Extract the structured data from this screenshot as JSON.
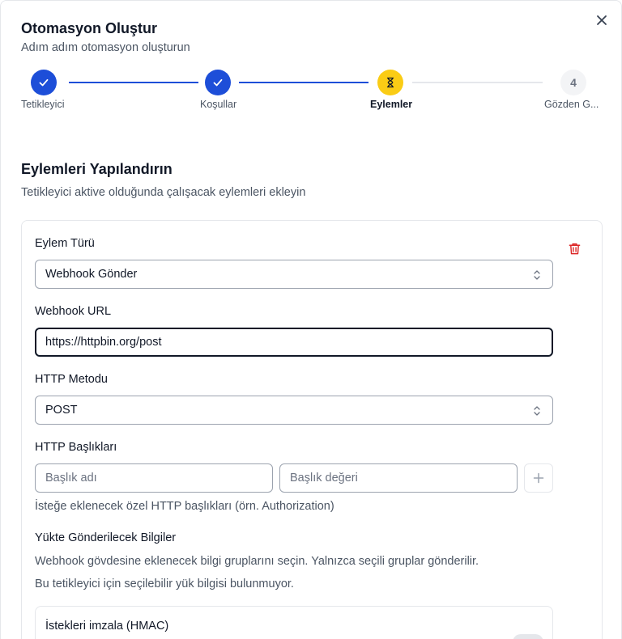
{
  "dialog": {
    "title": "Otomasyon Oluştur",
    "subtitle": "Adım adım otomasyon oluşturun"
  },
  "stepper": {
    "steps": [
      {
        "label": "Tetikleyici",
        "state": "done"
      },
      {
        "label": "Koşullar",
        "state": "done"
      },
      {
        "label": "Eylemler",
        "state": "active"
      },
      {
        "label": "Gözden G...",
        "state": "pending",
        "number": "4"
      }
    ]
  },
  "section": {
    "title": "Eylemleri Yapılandırın",
    "description": "Tetikleyici aktive olduğunda çalışacak eylemleri ekleyin"
  },
  "action": {
    "type_label": "Eylem Türü",
    "type_value": "Webhook Gönder",
    "url_label": "Webhook URL",
    "url_value": "https://httpbin.org/post",
    "method_label": "HTTP Metodu",
    "method_value": "POST",
    "headers_label": "HTTP Başlıkları",
    "header_name_placeholder": "Başlık adı",
    "header_value_placeholder": "Başlık değeri",
    "headers_helper": "İsteğe eklenecek özel HTTP başlıkları (örn. Authorization)",
    "payload_label": "Yükte Gönderilecek Bilgiler",
    "payload_desc": "Webhook gövdesine eklenecek bilgi gruplarını seçin. Yalnızca seçili gruplar gönderilir.",
    "payload_empty": "Bu tetikleyici için seçilebilir yük bilgisi bulunmuyor.",
    "hmac_title": "İstekleri imzala (HMAC)",
    "hmac_enabled": false
  },
  "colors": {
    "primary": "#1d4ed8",
    "active_step": "#facc15",
    "danger": "#dc2626"
  },
  "icons": {
    "close": "close-icon",
    "check": "check-icon",
    "hourglass": "hourglass-icon",
    "trash": "trash-icon",
    "chevron": "chevron-up-down-icon",
    "plus": "plus-icon"
  }
}
